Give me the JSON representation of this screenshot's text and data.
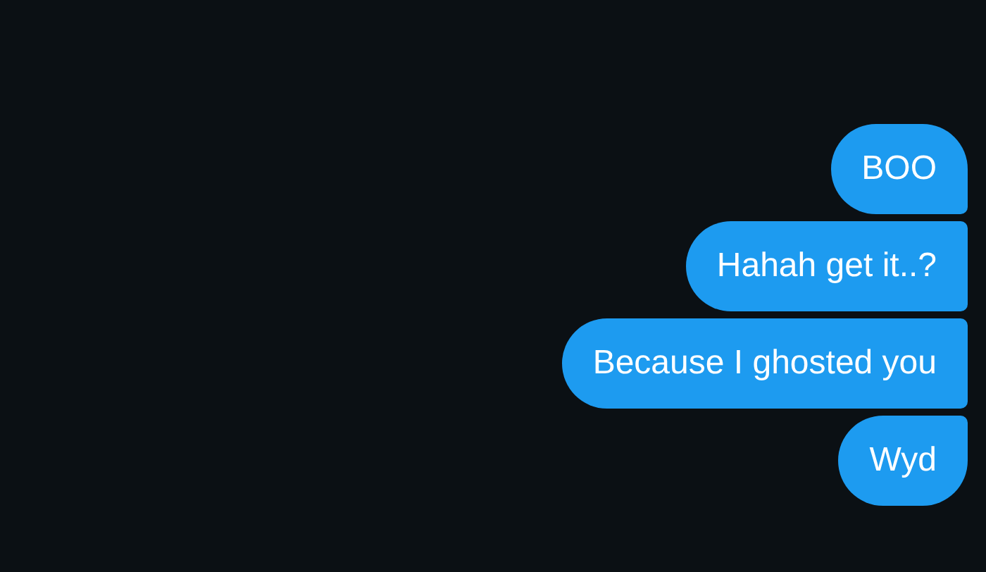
{
  "messages": [
    {
      "text": "BOO"
    },
    {
      "text": "Hahah get it..?"
    },
    {
      "text": "Because I ghosted you"
    },
    {
      "text": "Wyd"
    }
  ]
}
